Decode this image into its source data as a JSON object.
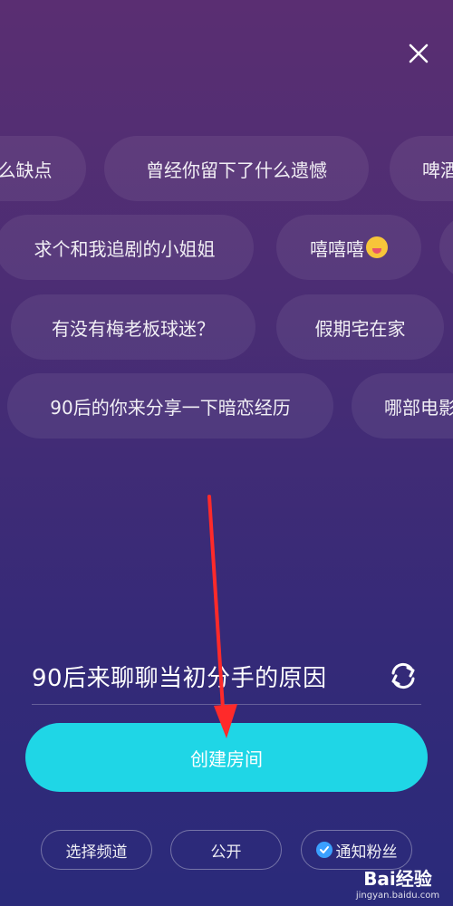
{
  "topics": [
    "么缺点",
    "曾经你留下了什么遗憾",
    "啤酒",
    "求个和我追剧的小姐姐",
    "嘻嘻嘻",
    "有没有梅老板球迷？",
    "假期宅在家",
    "90后的你来分享一下暗恋经历",
    "哪部电影"
  ],
  "current_topic": "90后来聊聊当初分手的原因",
  "create_button_label": "创建房间",
  "options": {
    "channel": "选择频道",
    "visibility": "公开",
    "notify_fans": "通知粉丝"
  },
  "watermark": {
    "brand": "Bai经验",
    "url": "jingyan.baidu.com"
  },
  "colors": {
    "accent": "#1fd6e6",
    "check": "#3aa0ff",
    "arrow": "#ff2a2a"
  }
}
